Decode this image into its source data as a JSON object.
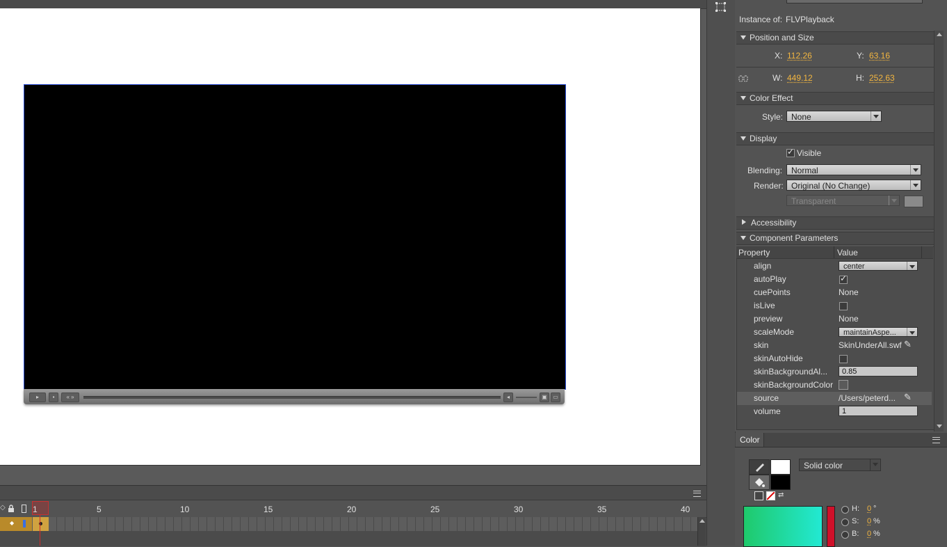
{
  "properties": {
    "instance_label": "Instance of:",
    "instance_value": "FLVPlayback",
    "position_size": {
      "title": "Position and Size",
      "x_label": "X:",
      "x_value": "112.26",
      "y_label": "Y:",
      "y_value": "63.16",
      "w_label": "W:",
      "w_value": "449.12",
      "h_label": "H:",
      "h_value": "252.63"
    },
    "color_effect": {
      "title": "Color Effect",
      "style_label": "Style:",
      "style_value": "None"
    },
    "display": {
      "title": "Display",
      "visible_label": "Visible",
      "visible_checked": true,
      "blending_label": "Blending:",
      "blending_value": "Normal",
      "render_label": "Render:",
      "render_value": "Original (No Change)",
      "bg_value": "Transparent"
    },
    "accessibility": {
      "title": "Accessibility"
    },
    "component_params": {
      "title": "Component Parameters",
      "col_property": "Property",
      "col_value": "Value",
      "rows": [
        {
          "name": "align",
          "value": "center",
          "kind": "dropdown"
        },
        {
          "name": "autoPlay",
          "value": "",
          "kind": "checkbox",
          "checked": true
        },
        {
          "name": "cuePoints",
          "value": "None",
          "kind": "text"
        },
        {
          "name": "isLive",
          "value": "",
          "kind": "checkbox",
          "checked": false
        },
        {
          "name": "preview",
          "value": "None",
          "kind": "text"
        },
        {
          "name": "scaleMode",
          "value": "maintainAspe...",
          "kind": "dropdown"
        },
        {
          "name": "skin",
          "value": "SkinUnderAll.swf",
          "kind": "file"
        },
        {
          "name": "skinAutoHide",
          "value": "",
          "kind": "checkbox",
          "checked": false
        },
        {
          "name": "skinBackgroundAl...",
          "value": "0.85",
          "kind": "input"
        },
        {
          "name": "skinBackgroundColor",
          "value": "",
          "kind": "swatch"
        },
        {
          "name": "source",
          "value": "/Users/peterd...",
          "kind": "file"
        },
        {
          "name": "volume",
          "value": "1",
          "kind": "input"
        }
      ]
    }
  },
  "color_panel": {
    "tab_label": "Color",
    "fill_type": "Solid color",
    "stroke_color": "#ffffff",
    "fill_color": "#000000",
    "h_label": "H:",
    "h_value": "0",
    "h_unit": "°",
    "s_label": "S:",
    "s_value": "0",
    "s_unit": "%",
    "b_label": "B:",
    "b_value": "0",
    "b_unit": "%"
  },
  "timeline": {
    "frame_numbers": [
      "1",
      "5",
      "10",
      "15",
      "20",
      "25",
      "30",
      "35",
      "40"
    ],
    "current_frame": 1
  },
  "colors": {
    "accent_value": "#f3b640",
    "stage_bg": "#ffffff",
    "video_bg": "#000000",
    "selection_border": "#2b4fd8",
    "playhead": "#d02c2c"
  }
}
